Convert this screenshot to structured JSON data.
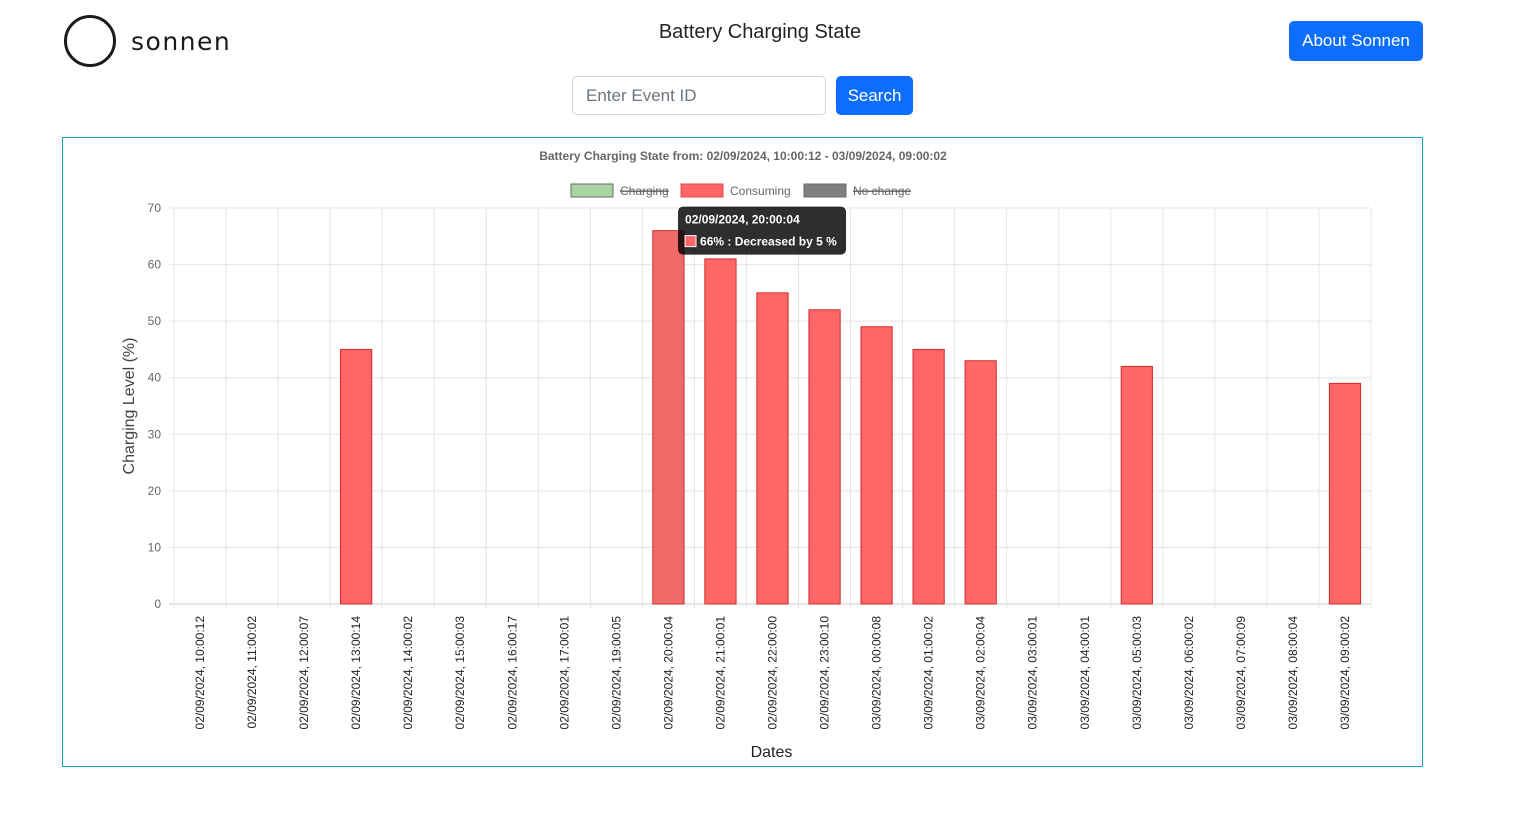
{
  "header": {
    "logo_text": "sonnen",
    "page_title": "Battery Charging State",
    "about_label": "About Sonnen"
  },
  "search": {
    "placeholder": "Enter Event ID",
    "button_label": "Search"
  },
  "colors": {
    "primary": "#0d6efd",
    "card_border": "#17a2b8",
    "charging": "#a8d5a2",
    "consuming": "#ff6666",
    "no_change": "#808080"
  },
  "chart_data": {
    "type": "bar",
    "title": "Battery Charging State from: 02/09/2024, 10:00:12 - 03/09/2024, 09:00:02",
    "xlabel": "Dates",
    "ylabel": "Charging Level (%)",
    "ylim": [
      0,
      70
    ],
    "yticks": [
      0,
      10,
      20,
      30,
      40,
      50,
      60,
      70
    ],
    "grid": true,
    "legend_position": "top-center",
    "legend": [
      {
        "label": "Charging",
        "color": "#a8d5a2",
        "hidden": true
      },
      {
        "label": "Consuming",
        "color": "#ff6666",
        "hidden": false
      },
      {
        "label": "No change",
        "color": "#808080",
        "hidden": true
      }
    ],
    "categories": [
      "02/09/2024, 10:00:12",
      "02/09/2024, 11:00:02",
      "02/09/2024, 12:00:07",
      "02/09/2024, 13:00:14",
      "02/09/2024, 14:00:02",
      "02/09/2024, 15:00:03",
      "02/09/2024, 16:00:17",
      "02/09/2024, 17:00:01",
      "02/09/2024, 19:00:05",
      "02/09/2024, 20:00:04",
      "02/09/2024, 21:00:01",
      "02/09/2024, 22:00:00",
      "02/09/2024, 23:00:10",
      "03/09/2024, 00:00:08",
      "03/09/2024, 01:00:02",
      "03/09/2024, 02:00:04",
      "03/09/2024, 03:00:01",
      "03/09/2024, 04:00:01",
      "03/09/2024, 05:00:03",
      "03/09/2024, 06:00:02",
      "03/09/2024, 07:00:09",
      "03/09/2024, 08:00:04",
      "03/09/2024, 09:00:02"
    ],
    "series": [
      {
        "name": "Consuming",
        "color": "#ff6666",
        "values": [
          null,
          null,
          null,
          45,
          null,
          null,
          null,
          null,
          null,
          66,
          61,
          55,
          52,
          49,
          45,
          43,
          null,
          null,
          42,
          null,
          null,
          null,
          39
        ]
      }
    ],
    "tooltip": {
      "category_index": 9,
      "title": "02/09/2024, 20:00:04",
      "body": "66% :  Decreased by 5 %"
    }
  }
}
